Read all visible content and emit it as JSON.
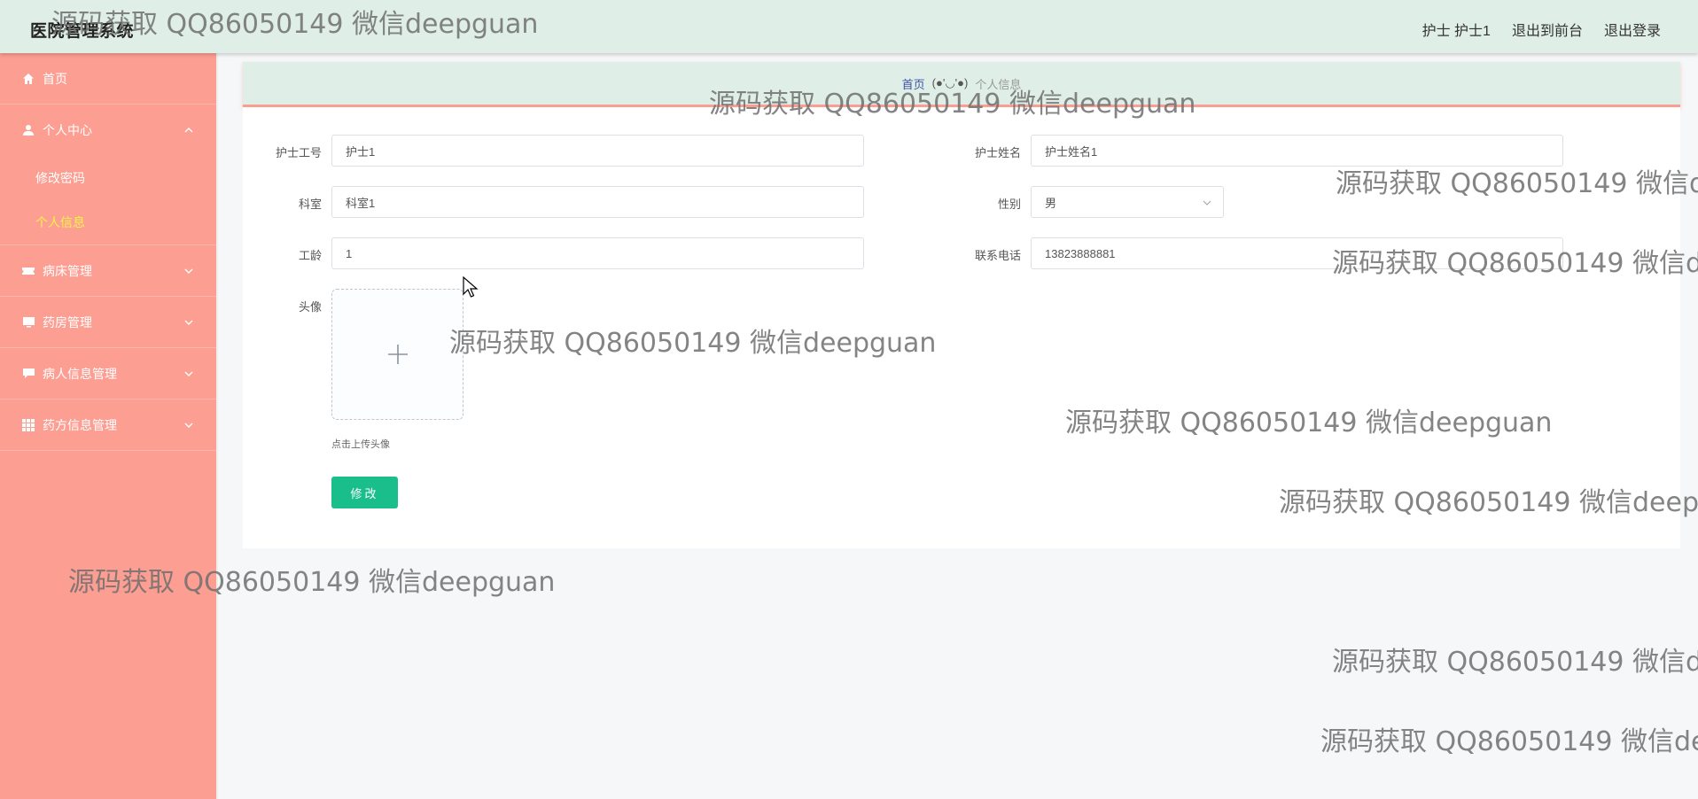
{
  "header": {
    "app_title": "医院管理系统",
    "user_label": "护士 护士1",
    "front_label": "退出到前台",
    "logout_label": "退出登录"
  },
  "sidebar": {
    "home": "首页",
    "personal_center": "个人中心",
    "personal_sub": [
      "修改密码",
      "个人信息"
    ],
    "items": [
      "病床管理",
      "药房管理",
      "病人信息管理",
      "药方信息管理"
    ]
  },
  "breadcrumb": {
    "home": "首页",
    "separator": "(●'◡'●)",
    "current": "个人信息"
  },
  "form": {
    "nurse_no_label": "护士工号",
    "nurse_no_value": "护士1",
    "nurse_name_label": "护士姓名",
    "nurse_name_value": "护士姓名1",
    "dept_label": "科室",
    "dept_value": "科室1",
    "gender_label": "性别",
    "gender_value": "男",
    "years_label": "工龄",
    "years_value": "1",
    "phone_label": "联系电话",
    "phone_value": "13823888881",
    "avatar_label": "头像",
    "upload_hint": "点击上传头像",
    "submit_label": "修改"
  },
  "watermark": "源码获取 QQ86050149 微信deepguan",
  "colors": {
    "header_bg": "#dfeee7",
    "sidebar_bg": "#fd9e92",
    "active_sub": "#f7f24a",
    "button": "#19be8b",
    "breadcrumb_home": "#3f51a5"
  }
}
